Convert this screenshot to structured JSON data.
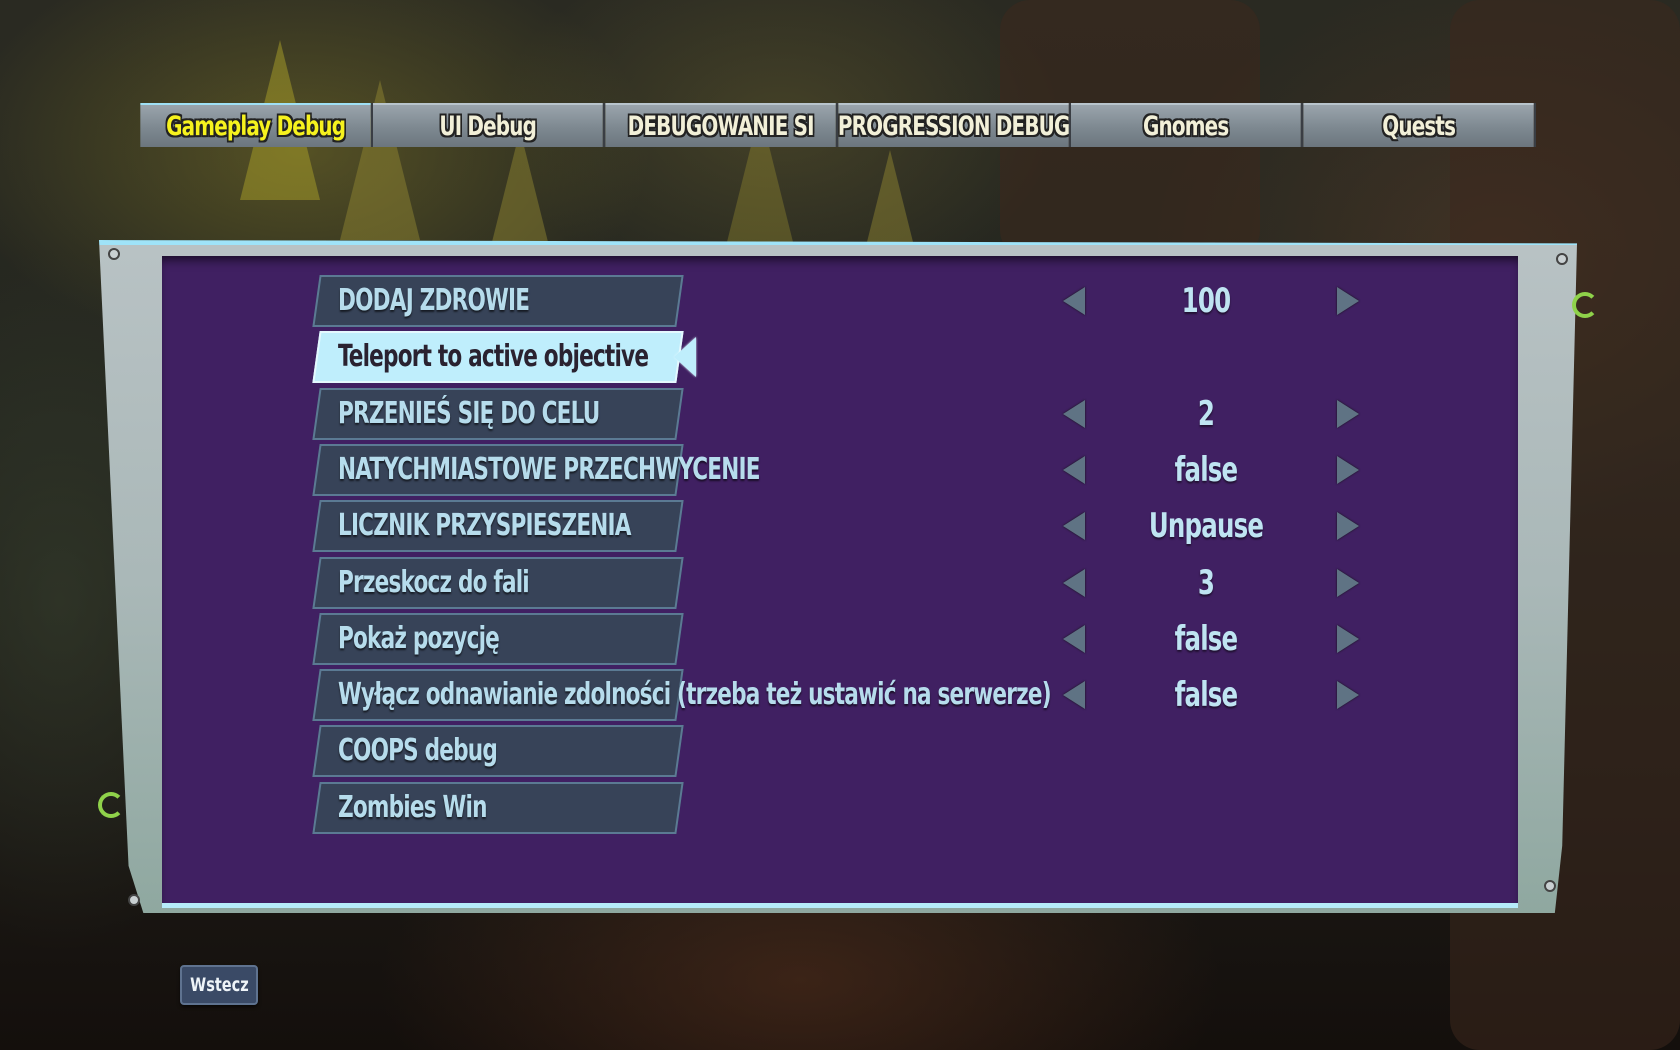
{
  "tabs": [
    {
      "label": "Gameplay Debug",
      "active": true
    },
    {
      "label": "UI Debug",
      "active": false
    },
    {
      "label": "DEBUGOWANIE SI",
      "active": false
    },
    {
      "label": "PROGRESSION DEBUG",
      "active": false
    },
    {
      "label": "Gnomes",
      "active": false
    },
    {
      "label": "Quests",
      "active": false
    }
  ],
  "options": [
    {
      "label": "DODAJ ZDROWIE",
      "value": "100",
      "has_value": true,
      "selected": false
    },
    {
      "label": "Teleport to active objective",
      "value": null,
      "has_value": false,
      "selected": true
    },
    {
      "label": "PRZENIEŚ SIĘ DO CELU",
      "value": "2",
      "has_value": true,
      "selected": false
    },
    {
      "label": "NATYCHMIASTOWE PRZECHWYCENIE",
      "value": "false",
      "has_value": true,
      "selected": false
    },
    {
      "label": "LICZNIK PRZYSPIESZENIA",
      "value": "Unpause",
      "has_value": true,
      "selected": false
    },
    {
      "label": "Przeskocz do fali",
      "value": "3",
      "has_value": true,
      "selected": false
    },
    {
      "label": "Pokaż pozycję",
      "value": "false",
      "has_value": true,
      "selected": false
    },
    {
      "label": "Wyłącz odnawianie zdolności (trzeba też ustawić na serwerze)",
      "value": "false",
      "has_value": true,
      "selected": false
    },
    {
      "label": "COOPS debug",
      "value": null,
      "has_value": false,
      "selected": false
    },
    {
      "label": "Zombies Win",
      "value": null,
      "has_value": false,
      "selected": false
    }
  ],
  "icons": {
    "decrement": "triangle-left-icon",
    "increment": "triangle-right-icon",
    "selection": "selection-pointer-icon"
  },
  "back_button": {
    "label": "Wstecz"
  },
  "colors": {
    "panel_purple": "#402062",
    "active_tab_text": "#f6f21e",
    "tab_text": "#f2f0d8",
    "option_bg": "#374358",
    "option_text": "#b6dcec",
    "selected_bg": "#bfeefc",
    "selected_text": "#2a2230",
    "panel_frame": "#aab8b8",
    "frame_highlight": "#9fe3f8"
  }
}
